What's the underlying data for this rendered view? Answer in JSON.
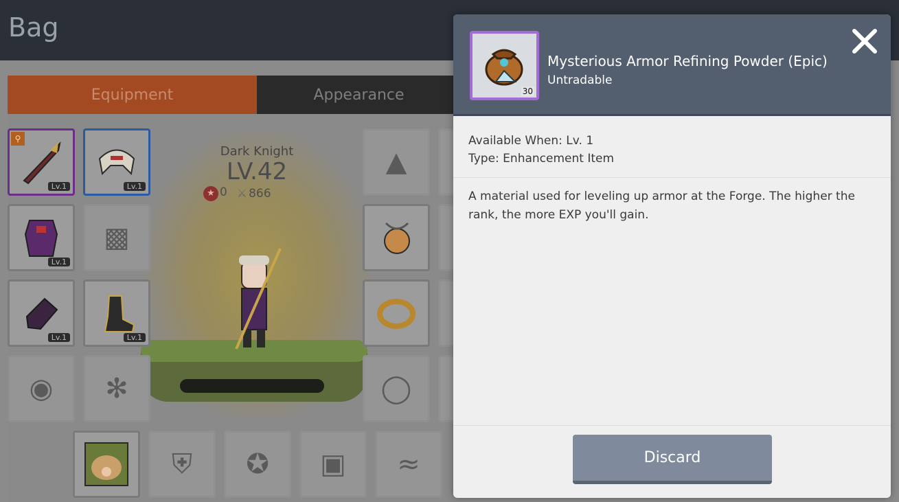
{
  "bag": {
    "title": "Bag",
    "tabs": [
      {
        "label": "Equipment",
        "active": true
      },
      {
        "label": "Appearance",
        "active": false
      }
    ],
    "character": {
      "class_name": "Dark Knight",
      "level": "LV.42",
      "star_force": "0",
      "attack_power": "866"
    },
    "slot_level_label": "Lv.1"
  },
  "dialog": {
    "item_name": "Mysterious Armor Refining Powder (Epic)",
    "trade_status": "Untradable",
    "item_count": "30",
    "item_icon": "powder-bag-icon",
    "available_when": "Available When: Lv. 1",
    "type": "Type: Enhancement Item",
    "description": "A material used for leveling up armor at the Forge. The higher the rank, the more EXP you'll gain.",
    "discard_label": "Discard"
  },
  "colors": {
    "dialog_header": "#535e6f",
    "epic_border": "#a36bd6",
    "discard_button": "#7f8b9c",
    "equipment_tab": "#a44a22"
  }
}
